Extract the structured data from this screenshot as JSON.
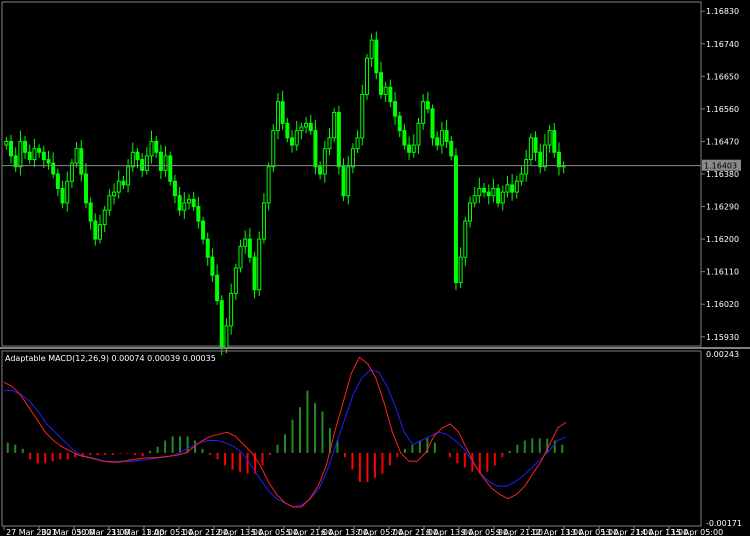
{
  "main_chart": {
    "price_ticks": [
      "1.16830",
      "1.16740",
      "1.16650",
      "1.16560",
      "1.16470",
      "1.16380",
      "1.16290",
      "1.16200",
      "1.16110",
      "1.16020",
      "1.15930"
    ],
    "current_price": "1.16403",
    "current_price_value": 1.16403,
    "y_range": [
      1.1591,
      1.1685
    ],
    "colors": {
      "bull": "#00ff00",
      "bear": "#ffffff",
      "price_line": "#8a8a8a",
      "grid": "#808080",
      "background": "#000000"
    }
  },
  "indicator": {
    "title": "Adaptable MACD(12,26,9) 0.00074 0.00039 0.00035",
    "max_label": "0.00243",
    "min_label": "-0.00171",
    "y_range": [
      -0.00171,
      0.00243
    ],
    "colors": {
      "hist_pos": "#228b22",
      "hist_neg": "#ff0000",
      "macd_line": "#ff2020",
      "signal_line": "#2020ff"
    }
  },
  "time_axis": {
    "labels": [
      "27 Mar 2021",
      "30 Mar 05:00",
      "30 Mar 21:00",
      "31 Mar 13:00",
      "1 Apr 05:00",
      "1 Apr 21:00",
      "2 Apr 13:00",
      "5 Apr 05:00",
      "5 Apr 21:00",
      "6 Apr 13:00",
      "7 Apr 05:00",
      "7 Apr 21:00",
      "8 Apr 13:00",
      "9 Apr 05:00",
      "9 Apr 21:00",
      "12 Apr 13:00",
      "13 Apr 05:00",
      "13 Apr 21:00",
      "14 Apr 13:00",
      "15 Apr 05:00"
    ]
  },
  "chart_data": {
    "type": "candlestick",
    "closes": [
      1.1647,
      1.1643,
      1.164,
      1.1647,
      1.1644,
      1.1642,
      1.1645,
      1.1644,
      1.1642,
      1.1641,
      1.1638,
      1.1634,
      1.163,
      1.1636,
      1.1641,
      1.1645,
      1.1638,
      1.163,
      1.1625,
      1.162,
      1.1624,
      1.1628,
      1.1632,
      1.1633,
      1.1636,
      1.1635,
      1.164,
      1.1644,
      1.1642,
      1.1639,
      1.1643,
      1.1647,
      1.1644,
      1.1639,
      1.1643,
      1.1636,
      1.1632,
      1.1628,
      1.163,
      1.1631,
      1.1629,
      1.1625,
      1.162,
      1.1615,
      1.161,
      1.1603,
      1.159,
      1.1596,
      1.1605,
      1.1612,
      1.1618,
      1.162,
      1.1615,
      1.1606,
      1.162,
      1.163,
      1.164,
      1.165,
      1.1658,
      1.1652,
      1.1648,
      1.1646,
      1.165,
      1.1651,
      1.1652,
      1.165,
      1.164,
      1.1638,
      1.1645,
      1.1648,
      1.1655,
      1.164,
      1.1632,
      1.164,
      1.1645,
      1.1648,
      1.166,
      1.167,
      1.1675,
      1.1666,
      1.166,
      1.1662,
      1.1658,
      1.1654,
      1.165,
      1.1646,
      1.1644,
      1.1646,
      1.1652,
      1.1658,
      1.1656,
      1.1648,
      1.1646,
      1.165,
      1.1647,
      1.1643,
      1.1608,
      1.1615,
      1.1625,
      1.163,
      1.1632,
      1.1634,
      1.1633,
      1.1632,
      1.1634,
      1.163,
      1.1633,
      1.1635,
      1.1633,
      1.1636,
      1.1638,
      1.1642,
      1.1648,
      1.1644,
      1.164,
      1.1646,
      1.165,
      1.1644,
      1.164,
      1.16403
    ],
    "macd": [
      0.0017,
      0.0016,
      0.0014,
      0.0011,
      0.0008,
      0.0005,
      0.0003,
      0.00015,
      5e-05,
      -5e-05,
      -0.0001,
      -0.00015,
      -0.0002,
      -0.00022,
      -0.00022,
      -0.00018,
      -0.00015,
      -0.00012,
      -0.00012,
      -0.0001,
      -8e-05,
      -5e-05,
      0.0,
      0.00015,
      0.0003,
      0.0004,
      0.00045,
      0.0005,
      0.0004,
      0.0002,
      0.0,
      -0.0003,
      -0.0007,
      -0.001,
      -0.0012,
      -0.0013,
      -0.0013,
      -0.0011,
      -0.0008,
      -0.0003,
      0.0005,
      0.0012,
      0.0019,
      0.0023,
      0.00215,
      0.0018,
      0.0012,
      0.0005,
      0.0,
      -0.0002,
      -0.0002,
      0.0,
      0.0004,
      0.0006,
      0.0007,
      0.0005,
      0.0001,
      -0.0003,
      -0.0006,
      -0.00085,
      -0.001,
      -0.0011,
      -0.001,
      -0.0008,
      -0.0005,
      -0.0002,
      0.0002,
      0.0006,
      0.00074
    ],
    "signal": [
      0.0015,
      0.0015,
      0.0014,
      0.00125,
      0.001,
      0.0007,
      0.0005,
      0.0003,
      0.0001,
      -5e-05,
      -0.0001,
      -0.00015,
      -0.0002,
      -0.0002,
      -0.0002,
      -0.0002,
      -0.00018,
      -0.00015,
      -0.00012,
      -0.0001,
      -5e-05,
      5e-05,
      0.00015,
      0.00025,
      0.0003,
      0.0003,
      0.00025,
      0.00015,
      0.0,
      -0.0003,
      -0.0006,
      -0.0009,
      -0.0011,
      -0.0012,
      -0.0013,
      -0.00125,
      -0.0011,
      -0.00085,
      -0.0004,
      0.0002,
      0.0008,
      0.0014,
      0.0018,
      0.002,
      0.00195,
      0.0016,
      0.0011,
      0.0005,
      0.0002,
      0.0003,
      0.0004,
      0.0005,
      0.00045,
      0.0003,
      0.0001,
      -0.0002,
      -0.0005,
      -0.0007,
      -0.0008,
      -0.0008,
      -0.0007,
      -0.00055,
      -0.00035,
      -0.00015,
      5e-05,
      0.0003,
      0.00039
    ],
    "histogram": [
      0.00025,
      0.0002,
      0.0001,
      -0.00015,
      -0.00025,
      -0.00025,
      -0.0002,
      -0.00015,
      -0.00015,
      -0.0001,
      -0.0001,
      -5e-05,
      -5e-05,
      -5e-05,
      -5e-05,
      -2e-05,
      -2e-05,
      -5e-05,
      -8e-05,
      5e-05,
      0.00015,
      0.0003,
      0.0004,
      0.0004,
      0.0004,
      0.0003,
      0.0001,
      -5e-05,
      -0.00015,
      -0.0003,
      -0.0004,
      -0.00045,
      -0.0005,
      -0.0005,
      -0.0003,
      -5e-05,
      0.0002,
      0.00045,
      0.0008,
      0.0011,
      0.0015,
      0.0012,
      0.001,
      0.0006,
      0.0003,
      -0.0001,
      -0.0004,
      -0.0007,
      -0.0007,
      -0.0006,
      -0.0005,
      -0.0003,
      -0.0001,
      0.0001,
      0.0002,
      0.0003,
      0.00035,
      0.00025,
      0.0,
      -0.0001,
      -0.00025,
      -0.00035,
      -0.00045,
      -0.0005,
      -0.00045,
      -0.0003,
      -0.0001,
      5e-05,
      0.0002,
      0.0003,
      0.00035,
      0.00035,
      0.00035,
      0.0003,
      0.0002
    ]
  }
}
